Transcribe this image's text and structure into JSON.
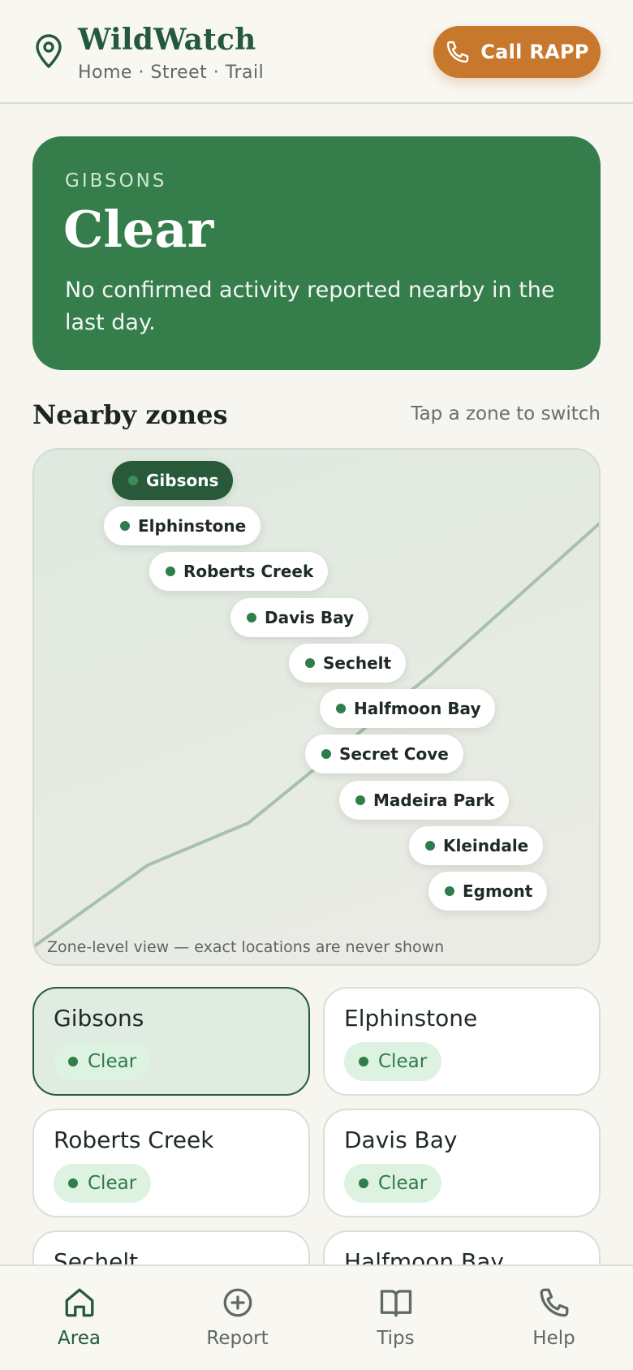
{
  "header": {
    "title": "WildWatch",
    "subtitle": "Home · Street · Trail",
    "call_label": "Call RAPP"
  },
  "status": {
    "area": "GIBSONS",
    "title": "Clear",
    "description": "No confirmed activity reported nearby in the last day."
  },
  "zones_section": {
    "title": "Nearby zones",
    "hint": "Tap a zone to switch",
    "map_note": "Zone-level view — exact locations are never shown"
  },
  "map_pills": [
    {
      "label": "Gibsons"
    },
    {
      "label": "Elphinstone"
    },
    {
      "label": "Roberts Creek"
    },
    {
      "label": "Davis Bay"
    },
    {
      "label": "Sechelt"
    },
    {
      "label": "Halfmoon Bay"
    },
    {
      "label": "Secret Cove"
    },
    {
      "label": "Madeira Park"
    },
    {
      "label": "Kleindale"
    },
    {
      "label": "Egmont"
    }
  ],
  "zone_cards": [
    {
      "name": "Gibsons",
      "status": "Clear"
    },
    {
      "name": "Elphinstone",
      "status": "Clear"
    },
    {
      "name": "Roberts Creek",
      "status": "Clear"
    },
    {
      "name": "Davis Bay",
      "status": "Clear"
    },
    {
      "name": "Sechelt",
      "status": ""
    },
    {
      "name": "Halfmoon Bay",
      "status": ""
    }
  ],
  "nav": {
    "area": "Area",
    "report": "Report",
    "tips": "Tips",
    "help": "Help"
  },
  "colors": {
    "brand": "#245a3b",
    "status_clear": "#357d4b",
    "call_accent": "#c7782c"
  }
}
